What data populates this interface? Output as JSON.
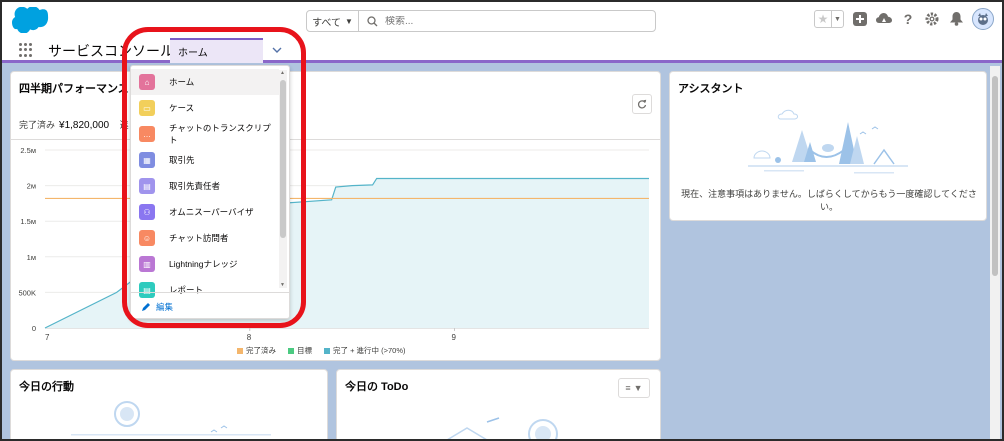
{
  "header": {
    "search_scope": "すべて",
    "search_placeholder": "検索..."
  },
  "nav": {
    "app_name": "サービスコンソール",
    "tab_label": "ホーム"
  },
  "dropdown": {
    "items": [
      {
        "label": "ホーム",
        "icon": "home-icon",
        "color": "#e3739b"
      },
      {
        "label": "ケース",
        "icon": "case-icon",
        "color": "#f2cf5b"
      },
      {
        "label": "チャットのトランスクリプト",
        "icon": "chat-transcript-icon",
        "color": "#f88962"
      },
      {
        "label": "取引先",
        "icon": "account-icon",
        "color": "#7f8de1"
      },
      {
        "label": "取引先責任者",
        "icon": "contact-icon",
        "color": "#a094ed"
      },
      {
        "label": "オムニスーパーバイザ",
        "icon": "omni-supervisor-icon",
        "color": "#8a76f0"
      },
      {
        "label": "チャット訪問者",
        "icon": "chat-visitor-icon",
        "color": "#f88962"
      },
      {
        "label": "Lightningナレッジ",
        "icon": "knowledge-icon",
        "color": "#ba77d4"
      },
      {
        "label": "レポート",
        "icon": "report-icon",
        "color": "#2ecbbe"
      }
    ],
    "edit_label": "編集"
  },
  "performance": {
    "title": "四半期パフォーマンス",
    "closed_label": "完了済み",
    "closed_value": "¥1,820,000",
    "extra_label": "進"
  },
  "chart_data": {
    "type": "line",
    "x_ticks": [
      "7",
      "8",
      "9"
    ],
    "y_ticks": [
      "0",
      "500K",
      "1м",
      "1.5м",
      "2м",
      "2.5м"
    ],
    "ylim": [
      0,
      2500000
    ],
    "series": [
      {
        "name": "完了済み",
        "color": "#f4b66c",
        "x": [
          7,
          9.95
        ],
        "y": [
          1820000,
          1820000
        ]
      },
      {
        "name": "目標",
        "color": "#4bca81",
        "x": [],
        "y": []
      },
      {
        "name": "完了 + 進行中 (>70%)",
        "color": "#54b4c9",
        "x": [
          7,
          7.35,
          7.9,
          8.4,
          8.42,
          8.5,
          8.6,
          8.62,
          9.95
        ],
        "y": [
          0,
          500000,
          1700000,
          1800000,
          1980000,
          2000000,
          2010000,
          2100000,
          2100000
        ]
      }
    ],
    "legend_position": "bottom"
  },
  "assistant": {
    "title": "アシスタント",
    "message": "現在、注意事項はありません。しばらくしてからもう一度確認してください。"
  },
  "today": {
    "title": "今日の行動"
  },
  "todo": {
    "title": "今日の ToDo"
  }
}
